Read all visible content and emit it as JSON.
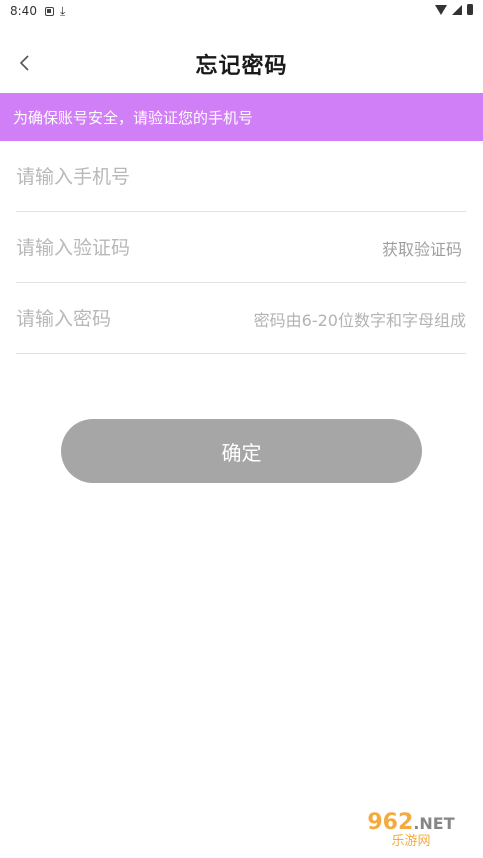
{
  "status_bar": {
    "time": "8:40"
  },
  "header": {
    "back_label": "<",
    "title": "忘记密码"
  },
  "banner": {
    "text": "为确保账号安全，请验证您的手机号",
    "color": "#d17ff6"
  },
  "form": {
    "phone": {
      "placeholder": "请输入手机号",
      "value": ""
    },
    "code": {
      "placeholder": "请输入验证码",
      "value": "",
      "get_code_label": "获取验证码"
    },
    "password": {
      "placeholder": "请输入密码",
      "value": "",
      "hint": "密码由6-20位数字和字母组成"
    }
  },
  "confirm_button": {
    "label": "确定",
    "color": "#a6a6a6"
  },
  "watermark": {
    "brand": "962",
    "suffix": ".NET",
    "name": "乐游网"
  }
}
